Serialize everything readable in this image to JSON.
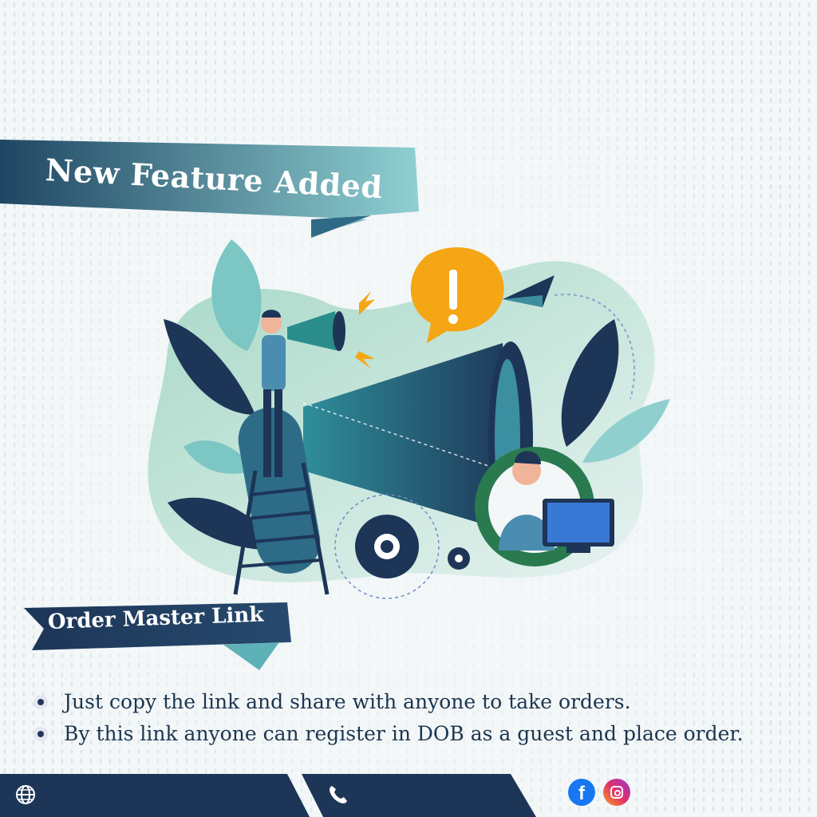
{
  "header": {
    "banner_title": "New Feature Added"
  },
  "section": {
    "title": "Order Master Link"
  },
  "features": [
    "Just copy the link and share with anyone to take orders.",
    "By this link anyone can register in DOB as a guest and place order."
  ],
  "footer": {
    "icons": [
      "globe-icon",
      "phone-icon"
    ],
    "social": [
      "facebook-icon",
      "instagram-icon"
    ]
  },
  "colors": {
    "navy": "#1d3557",
    "teal": "#6cc3c4",
    "accent_orange": "#f5a614",
    "text": "#1c3550"
  }
}
